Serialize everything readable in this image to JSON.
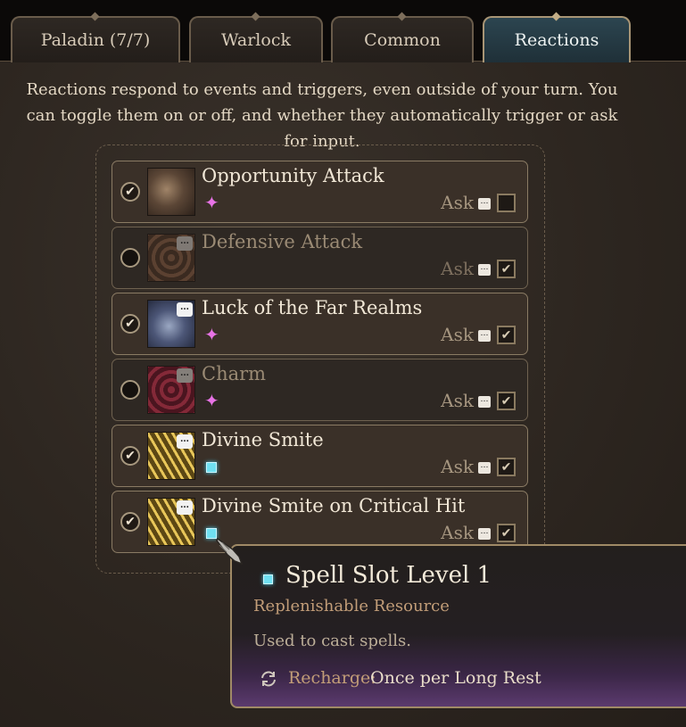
{
  "tabs": [
    {
      "label": "Paladin (7/7)",
      "active": false
    },
    {
      "label": "Warlock",
      "active": false
    },
    {
      "label": "Common",
      "active": false
    },
    {
      "label": "Reactions",
      "active": true
    }
  ],
  "intro": "Reactions respond to events and triggers, even outside of your turn. You can toggle them on or off, and whether they automatically trigger or ask for input.",
  "reactions": [
    {
      "name": "Opportunity Attack",
      "enabled": true,
      "ask_label": "Ask",
      "ask_checked": false,
      "resource_icon": "warlock-star-icon"
    },
    {
      "name": "Defensive Attack",
      "enabled": false,
      "ask_label": "Ask",
      "ask_checked": true,
      "resource_icon": "none"
    },
    {
      "name": "Luck of the Far Realms",
      "enabled": true,
      "ask_label": "Ask",
      "ask_checked": true,
      "resource_icon": "warlock-star-icon"
    },
    {
      "name": "Charm",
      "enabled": false,
      "ask_label": "Ask",
      "ask_checked": true,
      "resource_icon": "warlock-star-icon"
    },
    {
      "name": "Divine Smite",
      "enabled": true,
      "ask_label": "Ask",
      "ask_checked": true,
      "resource_icon": "spell-slot-icon"
    },
    {
      "name": "Divine Smite on Critical Hit",
      "enabled": true,
      "ask_label": "Ask",
      "ask_checked": true,
      "resource_icon": "spell-slot-icon"
    }
  ],
  "tooltip": {
    "title": "Spell Slot Level 1",
    "subtitle": "Replenishable Resource",
    "description": "Used to cast spells.",
    "recharge_label": "Recharge:",
    "recharge_value": "Once per Long Rest"
  },
  "colors": {
    "active_tab": "#2c4550",
    "spell_slot": "#6fe0f2",
    "warlock_star": "#e873e6",
    "tooltip_accent": "#c29d78"
  }
}
